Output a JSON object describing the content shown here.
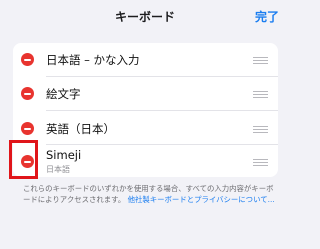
{
  "nav": {
    "title": "キーボード",
    "done_label": "完了"
  },
  "keyboards": [
    {
      "label": "日本語 – かな入力",
      "subtitle": ""
    },
    {
      "label": "絵文字",
      "subtitle": ""
    },
    {
      "label": "英語（日本）",
      "subtitle": ""
    },
    {
      "label": "Simeji",
      "subtitle": "日本語"
    }
  ],
  "icons": {
    "delete": "minus-circle-icon",
    "reorder": "reorder-handle-icon"
  },
  "footer": {
    "text": "これらのキーボードのいずれかを使用する場合、すべての入力内容がキーボードによりアクセスされます。",
    "link_text": "他社製キーボードとプライバシーについて..."
  },
  "colors": {
    "accent": "#1a7df0",
    "delete": "#e8342f",
    "highlight": "#e0151a",
    "background": "#f2f2f7"
  }
}
